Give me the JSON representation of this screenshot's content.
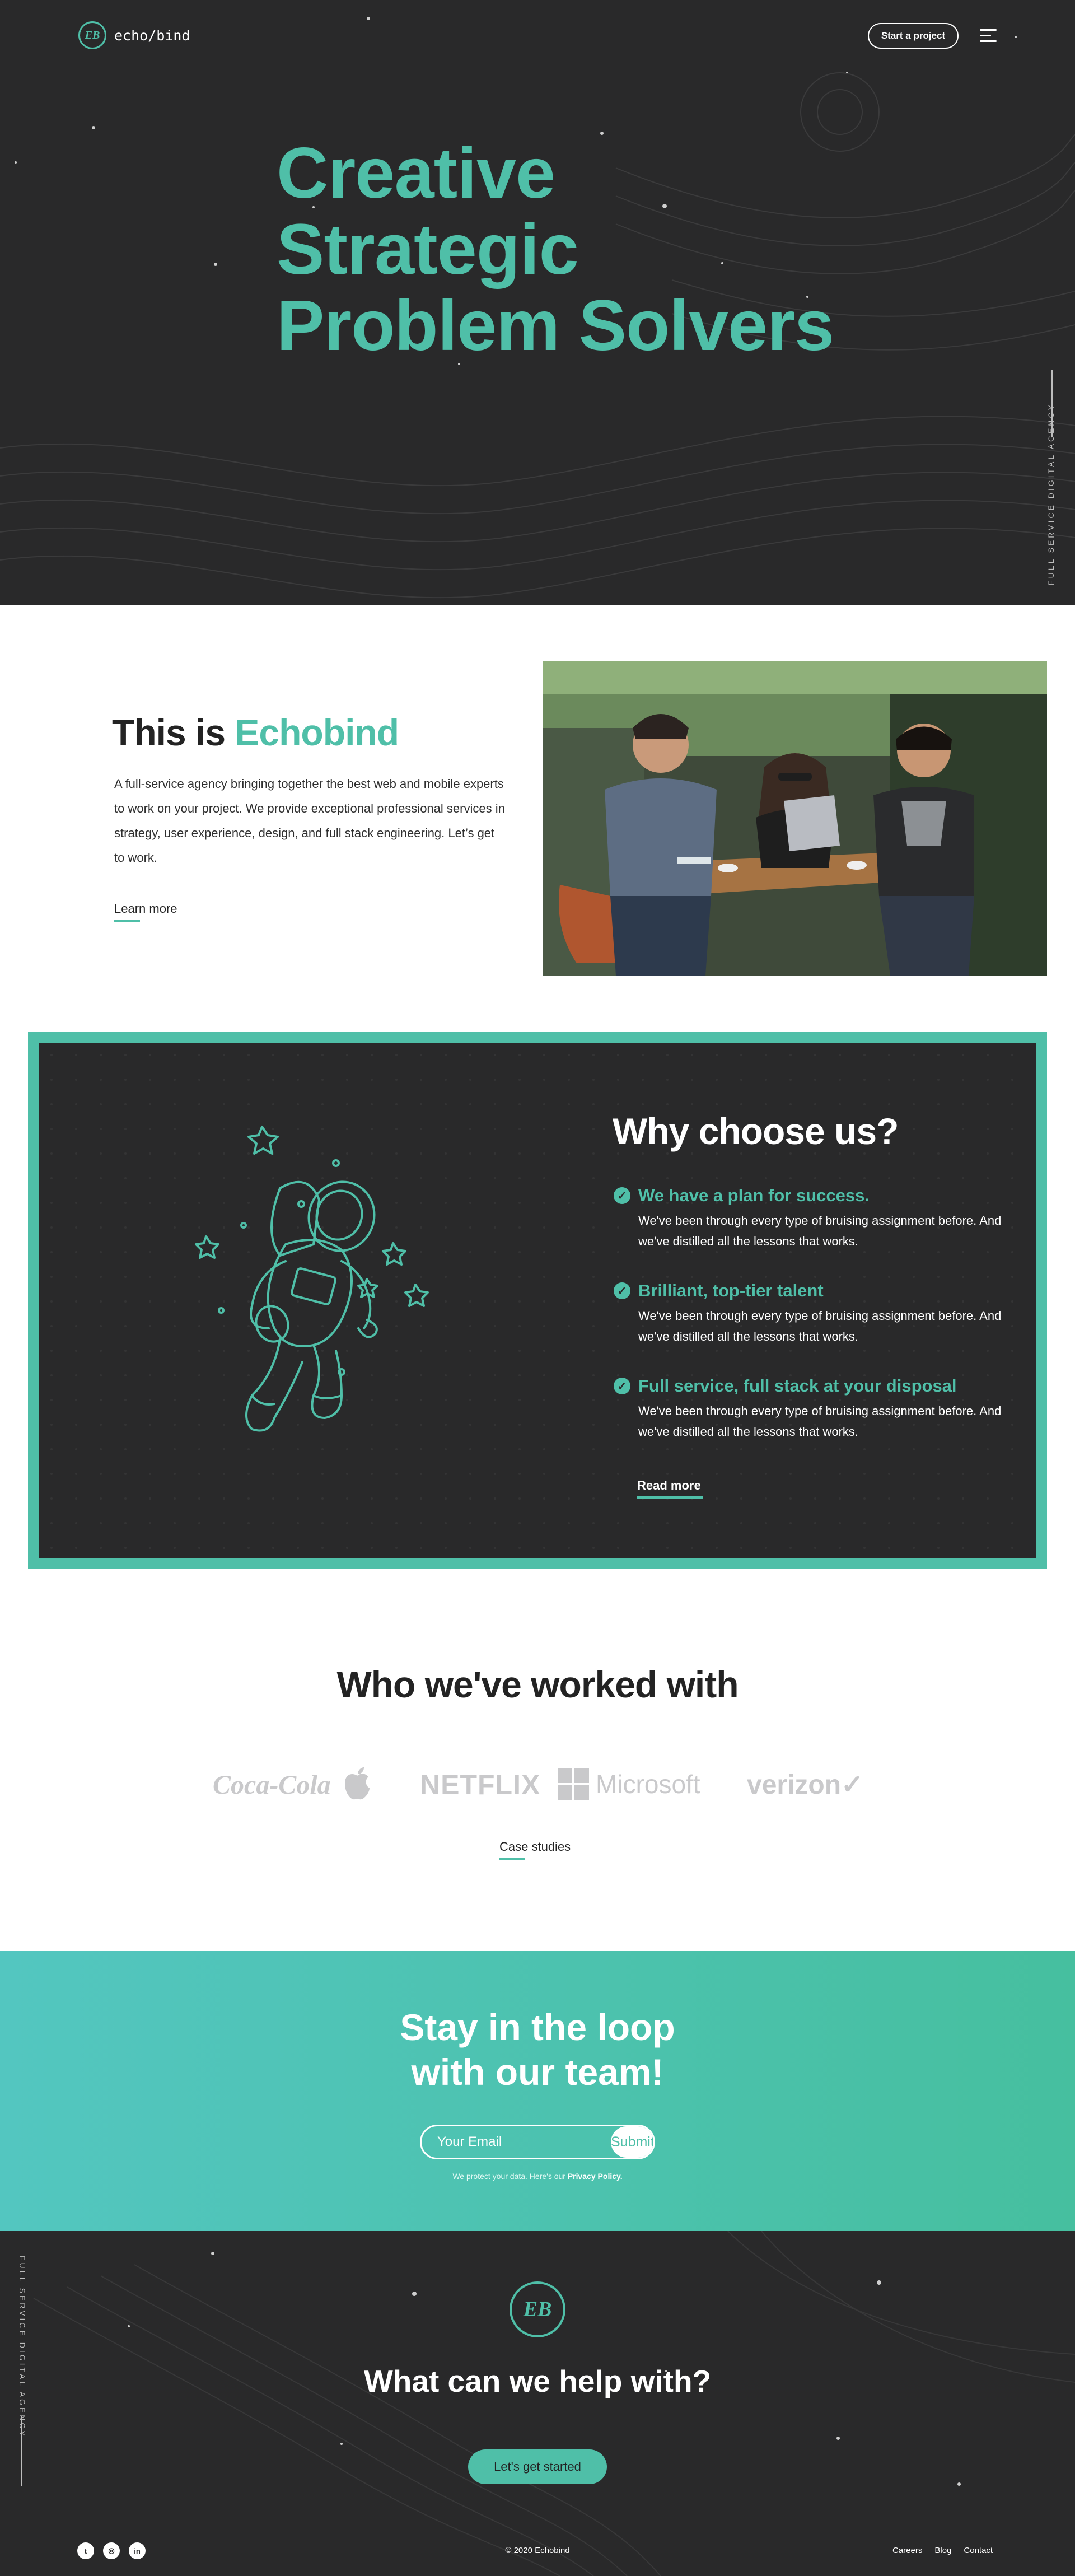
{
  "header": {
    "logo_mark": "EB",
    "logo_text": "echo/bind",
    "cta_label": "Start a project",
    "menu_icon": "hamburger-menu-icon"
  },
  "hero": {
    "title_lines": [
      "Creative",
      "Strategic",
      "Problem Solvers"
    ],
    "side_label": "FULL SERVICE DIGITAL AGENCY"
  },
  "about": {
    "title_prefix": "This is ",
    "title_accent": "Echobind",
    "body": "A full-service agency bringing together the best web and mobile experts to work on your project. We provide exceptional professional services in strategy, user experience, design, and full stack engineering. Let’s get to work.",
    "link": "Learn more",
    "photo_alt": "team-working-at-cafe-photo"
  },
  "why": {
    "title": "Why choose us?",
    "features": [
      {
        "heading": "We have a plan for success.",
        "body": "We've been through every type of bruising assignment before. And we've distilled all the lessons that works."
      },
      {
        "heading": "Brilliant, top-tier talent",
        "body": "We've been through every type of bruising assignment before. And we've distilled all the lessons that works."
      },
      {
        "heading": "Full service, full stack at your disposal",
        "body": "We've been through every type of bruising assignment before. And we've distilled all the lessons that works."
      }
    ],
    "link": "Read more",
    "accent_color": "#4fbfa8"
  },
  "clients": {
    "title": "Who we've worked with",
    "logos": [
      "Coca-Cola",
      "Apple",
      "NETFLIX",
      "Microsoft",
      "verizon✓"
    ],
    "link": "Case studies"
  },
  "newsletter": {
    "title_line1": "Stay in the loop",
    "title_line2": "with our team!",
    "placeholder": "Your Email",
    "submit": "Submit",
    "privacy_prefix": "We protect your data. Here's our ",
    "privacy_link": "Privacy Policy."
  },
  "footer": {
    "side_label": "FULL SERVICE DIGITAL AGENCY",
    "logo_mark": "EB",
    "title": "What can we help with?",
    "cta": "Let's get started",
    "social": [
      "twitter-icon",
      "instagram-icon",
      "linkedin-icon"
    ],
    "social_glyphs": [
      "t",
      "◎",
      "in"
    ],
    "copyright": "© 2020 Echobind",
    "links": [
      "Careers",
      "Blog",
      "Contact"
    ]
  }
}
